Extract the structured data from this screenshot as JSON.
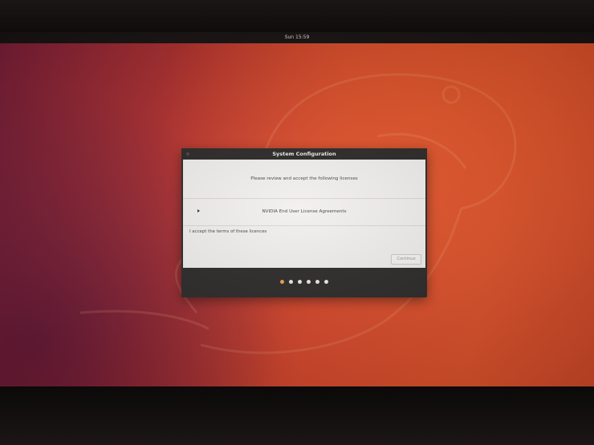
{
  "topbar": {
    "clock": "Sun 15:59"
  },
  "dialog": {
    "title": "System Configuration",
    "prompt": "Please review and accept the following licenses",
    "license_item": "NVIDIA End User License Agreements",
    "accept_label": "I accept the terms of these licences",
    "continue_label": "Continue"
  },
  "progress": {
    "steps": 6,
    "current_step": 1
  },
  "colors": {
    "wallpaper_orange": "#e2532b",
    "wallpaper_aubergine": "#7e1f3a",
    "dialog_frame": "#2c2a29",
    "dialog_body": "#f2f0ef",
    "active_dot": "#f0a050"
  }
}
